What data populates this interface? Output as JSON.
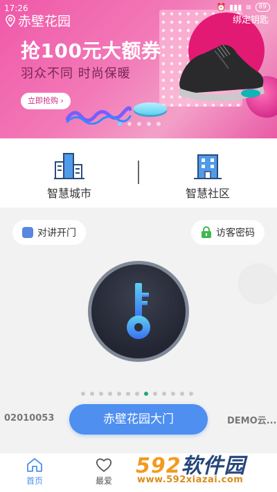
{
  "status_bar": {
    "time": "17:26",
    "battery": "89"
  },
  "header": {
    "location": "赤壁花园",
    "bind_key": "绑定钥匙"
  },
  "banner": {
    "title": "抢100元大额券",
    "subtitle": "羽众不同 时尚保暖",
    "button": "立即抢购",
    "slides": 5,
    "active_slide": 0
  },
  "smart": {
    "city_label": "智慧城市",
    "community_label": "智慧社区"
  },
  "actions": {
    "intercom": "对讲开门",
    "visitor_password": "访客密码"
  },
  "door": {
    "prev": "02010053",
    "current": "赤壁花园大门",
    "next": "DEMO云...",
    "pages": 13,
    "active_page": 7
  },
  "tabs": {
    "home": "首页",
    "favorite": "最爱"
  },
  "watermark": {
    "brand_num": "592",
    "brand_text": "软件园",
    "url": "www.592xiazai.com"
  },
  "colors": {
    "accent": "#4e8ff0",
    "active_dot": "#21a97a",
    "banner_pink": "#f058a8"
  }
}
